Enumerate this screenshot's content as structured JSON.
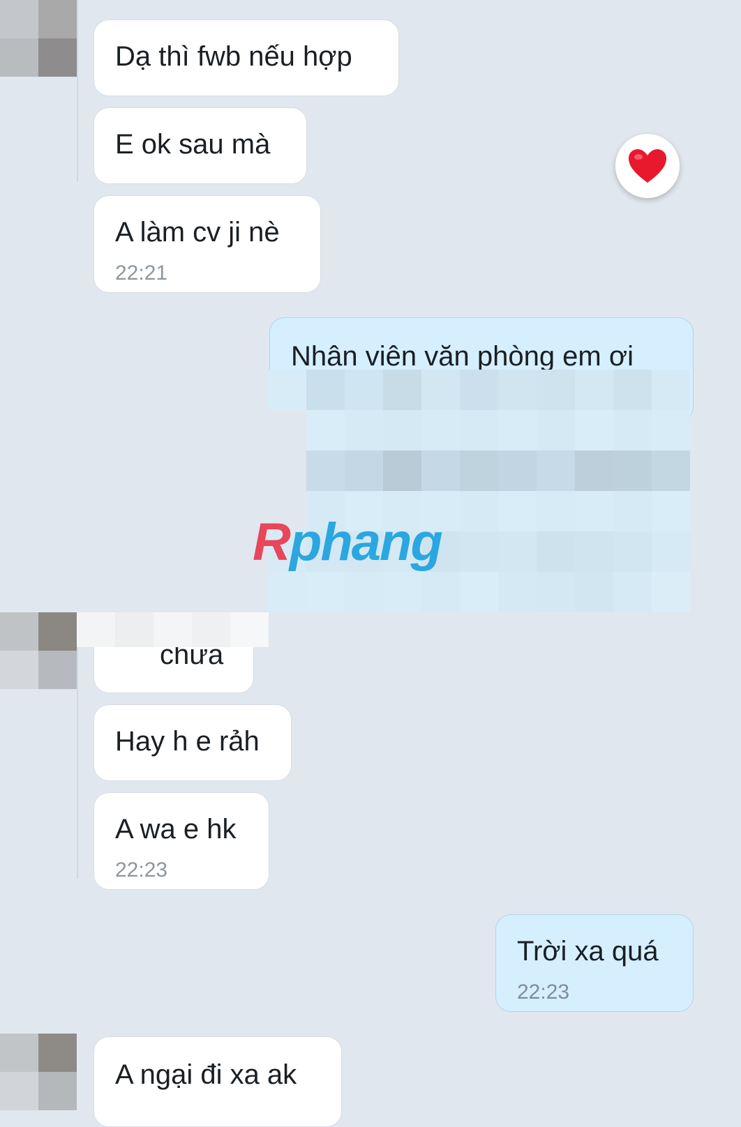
{
  "messages": {
    "m1": {
      "text": "Dạ thì fwb nếu hợp"
    },
    "m2": {
      "text": "E ok sau mà"
    },
    "m3": {
      "text": "A làm cv ji nè",
      "time": "22:21"
    },
    "m4": {
      "text": "Nhân viên văn phòng em ơi"
    },
    "m5": {
      "text": "chưa"
    },
    "m6": {
      "text": "Hay h e rảh"
    },
    "m7": {
      "text": "A wa e hk",
      "time": "22:23"
    },
    "m8": {
      "text": "Trời xa quá",
      "time": "22:23"
    },
    "m9": {
      "text": "A ngại đi xa ak"
    }
  },
  "watermark": {
    "first": "R",
    "rest": "phang"
  },
  "reaction": {
    "icon": "heart-icon",
    "color": "#e8192c"
  },
  "colors": {
    "incoming": "#ffffff",
    "outgoing": "#d6efff",
    "background": "#e1e7ee"
  }
}
